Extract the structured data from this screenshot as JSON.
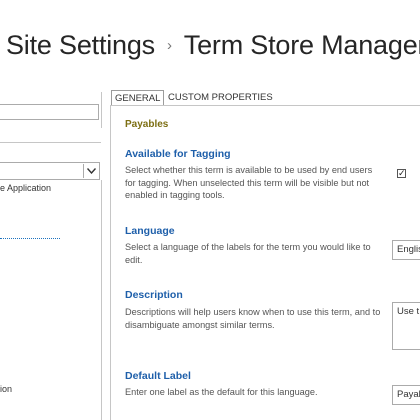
{
  "breadcrumb": {
    "parent": "Site Settings",
    "separator": "›",
    "current": "Term Store Manager"
  },
  "left_panel": {
    "search_value": "",
    "select_value": "",
    "tree_items": [
      "e Application",
      "ion"
    ]
  },
  "tabs": [
    {
      "label": "GENERAL",
      "active": true
    },
    {
      "label": "CUSTOM PROPERTIES",
      "active": false
    }
  ],
  "term": {
    "name": "Payables"
  },
  "sections": {
    "available": {
      "title": "Available for Tagging",
      "description": "Select whether this term is available to be used by end users for tagging. When unselected this term will be visible but not enabled in tagging tools.",
      "checked": true,
      "check_glyph": "✓"
    },
    "language": {
      "title": "Language",
      "description": "Select a language of the labels for the term you would like to edit.",
      "value": "Englis"
    },
    "description": {
      "title": "Description",
      "description": "Descriptions will help users know when to use this term, and to disambiguate amongst similar terms.",
      "value": "Use t"
    },
    "default_label": {
      "title": "Default Label",
      "description": "Enter one label as the default for this language.",
      "value": "Payab"
    }
  },
  "icons": {
    "breadcrumb_separator": "chevron-right-icon",
    "select_chevron": "chevron-down-icon",
    "checkbox": "check-icon"
  },
  "colors": {
    "section_title": "#1e5faa",
    "term_name": "#7d6f13",
    "border": "#c6c6c6"
  }
}
